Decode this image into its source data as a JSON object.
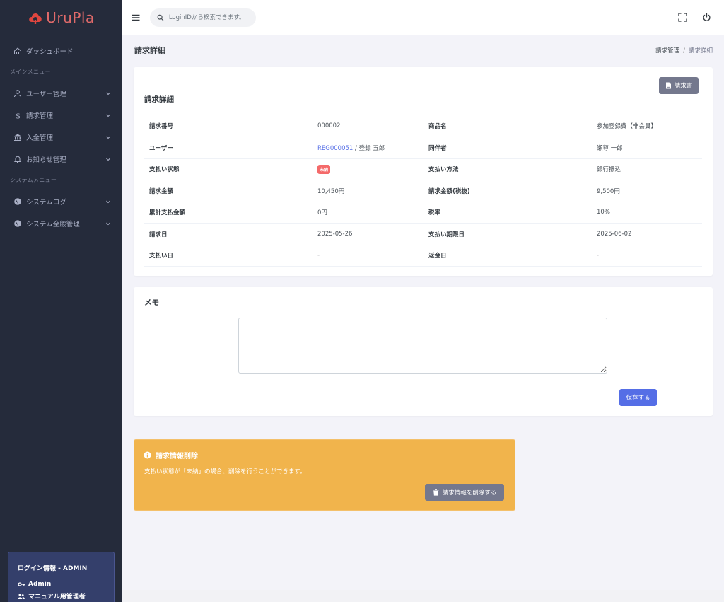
{
  "brand": {
    "name": "UruPla",
    "color": "#e0463f"
  },
  "sidebar": {
    "items_top": [
      {
        "label": "ダッシュボード",
        "icon": "home-icon"
      }
    ],
    "section_main": "メインメニュー",
    "main_items": [
      {
        "label": "ユーザー管理",
        "icon": "user-icon"
      },
      {
        "label": "請求管理",
        "icon": "dollar-icon"
      },
      {
        "label": "入金管理",
        "icon": "bank-icon"
      },
      {
        "label": "お知らせ管理",
        "icon": "bell-icon"
      }
    ],
    "section_system": "システムメニュー",
    "system_items": [
      {
        "label": "システムログ",
        "icon": "globe-icon"
      },
      {
        "label": "システム全般管理",
        "icon": "globe-icon"
      }
    ],
    "login": {
      "title": "ログイン情報 - ADMIN",
      "user": "Admin",
      "role": "マニュアル用管理者"
    }
  },
  "topbar": {
    "search_placeholder": "LoginIDから検索できます。"
  },
  "page": {
    "title": "請求詳細",
    "breadcrumb": {
      "parent": "請求管理",
      "sep": "/",
      "current": "請求詳細"
    }
  },
  "detail": {
    "title": "請求詳細",
    "invoice_button": "請求書",
    "rows": [
      {
        "k1": "請求番号",
        "v1": "000002",
        "k2": "商品名",
        "v2": "参加登録費【非会員】"
      },
      {
        "k1": "ユーザー",
        "v1_link": "REG000051",
        "v1": " / 登録 五郎",
        "k2": "同伴者",
        "v2": "瀬尊 一郎"
      },
      {
        "k1": "支払い状態",
        "badge": "未納",
        "k2": "支払い方法",
        "v2": "銀行振込"
      },
      {
        "k1": "請求金額",
        "v1": "10,450円",
        "k2": "請求金額(税抜)",
        "v2": "9,500円"
      },
      {
        "k1": "累計支払金額",
        "v1": "0円",
        "k2": "税率",
        "v2": "10%"
      },
      {
        "k1": "請求日",
        "v1": "2025-05-26",
        "k2": "支払い期限日",
        "v2": "2025-06-02"
      },
      {
        "k1": "支払い日",
        "v1": "-",
        "k2": "返金日",
        "v2": "-"
      }
    ]
  },
  "memo": {
    "title": "メモ",
    "value": "",
    "save_button": "保存する"
  },
  "delete_panel": {
    "title": "請求情報削除",
    "message": "支払い状態が「未納」の場合、削除を行うことができます。",
    "button": "請求情報を削除する",
    "color": "#f1b44c"
  }
}
